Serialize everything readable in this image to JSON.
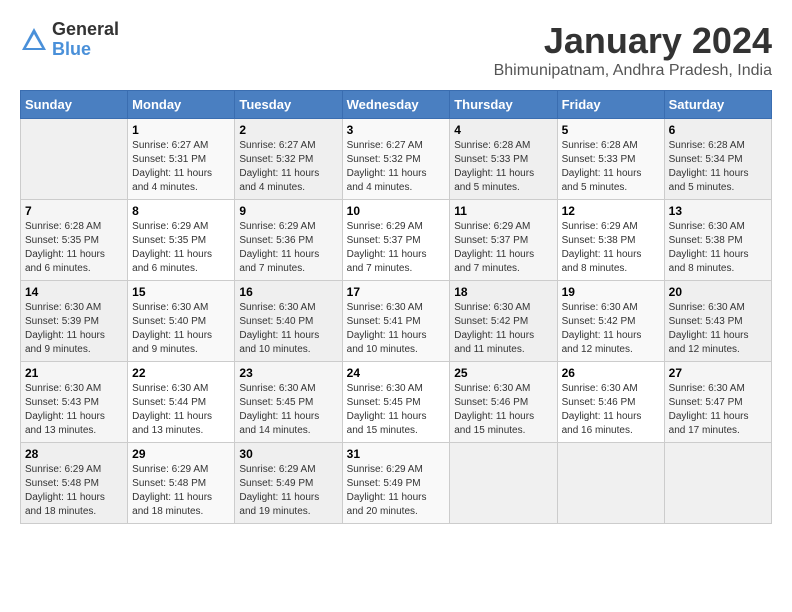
{
  "header": {
    "logo_general": "General",
    "logo_blue": "Blue",
    "main_title": "January 2024",
    "subtitle": "Bhimunipatnam, Andhra Pradesh, India"
  },
  "days_of_week": [
    "Sunday",
    "Monday",
    "Tuesday",
    "Wednesday",
    "Thursday",
    "Friday",
    "Saturday"
  ],
  "weeks": [
    [
      {
        "num": "",
        "info": ""
      },
      {
        "num": "1",
        "info": "Sunrise: 6:27 AM\nSunset: 5:31 PM\nDaylight: 11 hours\nand 4 minutes."
      },
      {
        "num": "2",
        "info": "Sunrise: 6:27 AM\nSunset: 5:32 PM\nDaylight: 11 hours\nand 4 minutes."
      },
      {
        "num": "3",
        "info": "Sunrise: 6:27 AM\nSunset: 5:32 PM\nDaylight: 11 hours\nand 4 minutes."
      },
      {
        "num": "4",
        "info": "Sunrise: 6:28 AM\nSunset: 5:33 PM\nDaylight: 11 hours\nand 5 minutes."
      },
      {
        "num": "5",
        "info": "Sunrise: 6:28 AM\nSunset: 5:33 PM\nDaylight: 11 hours\nand 5 minutes."
      },
      {
        "num": "6",
        "info": "Sunrise: 6:28 AM\nSunset: 5:34 PM\nDaylight: 11 hours\nand 5 minutes."
      }
    ],
    [
      {
        "num": "7",
        "info": "Sunrise: 6:28 AM\nSunset: 5:35 PM\nDaylight: 11 hours\nand 6 minutes."
      },
      {
        "num": "8",
        "info": "Sunrise: 6:29 AM\nSunset: 5:35 PM\nDaylight: 11 hours\nand 6 minutes."
      },
      {
        "num": "9",
        "info": "Sunrise: 6:29 AM\nSunset: 5:36 PM\nDaylight: 11 hours\nand 7 minutes."
      },
      {
        "num": "10",
        "info": "Sunrise: 6:29 AM\nSunset: 5:37 PM\nDaylight: 11 hours\nand 7 minutes."
      },
      {
        "num": "11",
        "info": "Sunrise: 6:29 AM\nSunset: 5:37 PM\nDaylight: 11 hours\nand 7 minutes."
      },
      {
        "num": "12",
        "info": "Sunrise: 6:29 AM\nSunset: 5:38 PM\nDaylight: 11 hours\nand 8 minutes."
      },
      {
        "num": "13",
        "info": "Sunrise: 6:30 AM\nSunset: 5:38 PM\nDaylight: 11 hours\nand 8 minutes."
      }
    ],
    [
      {
        "num": "14",
        "info": "Sunrise: 6:30 AM\nSunset: 5:39 PM\nDaylight: 11 hours\nand 9 minutes."
      },
      {
        "num": "15",
        "info": "Sunrise: 6:30 AM\nSunset: 5:40 PM\nDaylight: 11 hours\nand 9 minutes."
      },
      {
        "num": "16",
        "info": "Sunrise: 6:30 AM\nSunset: 5:40 PM\nDaylight: 11 hours\nand 10 minutes."
      },
      {
        "num": "17",
        "info": "Sunrise: 6:30 AM\nSunset: 5:41 PM\nDaylight: 11 hours\nand 10 minutes."
      },
      {
        "num": "18",
        "info": "Sunrise: 6:30 AM\nSunset: 5:42 PM\nDaylight: 11 hours\nand 11 minutes."
      },
      {
        "num": "19",
        "info": "Sunrise: 6:30 AM\nSunset: 5:42 PM\nDaylight: 11 hours\nand 12 minutes."
      },
      {
        "num": "20",
        "info": "Sunrise: 6:30 AM\nSunset: 5:43 PM\nDaylight: 11 hours\nand 12 minutes."
      }
    ],
    [
      {
        "num": "21",
        "info": "Sunrise: 6:30 AM\nSunset: 5:43 PM\nDaylight: 11 hours\nand 13 minutes."
      },
      {
        "num": "22",
        "info": "Sunrise: 6:30 AM\nSunset: 5:44 PM\nDaylight: 11 hours\nand 13 minutes."
      },
      {
        "num": "23",
        "info": "Sunrise: 6:30 AM\nSunset: 5:45 PM\nDaylight: 11 hours\nand 14 minutes."
      },
      {
        "num": "24",
        "info": "Sunrise: 6:30 AM\nSunset: 5:45 PM\nDaylight: 11 hours\nand 15 minutes."
      },
      {
        "num": "25",
        "info": "Sunrise: 6:30 AM\nSunset: 5:46 PM\nDaylight: 11 hours\nand 15 minutes."
      },
      {
        "num": "26",
        "info": "Sunrise: 6:30 AM\nSunset: 5:46 PM\nDaylight: 11 hours\nand 16 minutes."
      },
      {
        "num": "27",
        "info": "Sunrise: 6:30 AM\nSunset: 5:47 PM\nDaylight: 11 hours\nand 17 minutes."
      }
    ],
    [
      {
        "num": "28",
        "info": "Sunrise: 6:29 AM\nSunset: 5:48 PM\nDaylight: 11 hours\nand 18 minutes."
      },
      {
        "num": "29",
        "info": "Sunrise: 6:29 AM\nSunset: 5:48 PM\nDaylight: 11 hours\nand 18 minutes."
      },
      {
        "num": "30",
        "info": "Sunrise: 6:29 AM\nSunset: 5:49 PM\nDaylight: 11 hours\nand 19 minutes."
      },
      {
        "num": "31",
        "info": "Sunrise: 6:29 AM\nSunset: 5:49 PM\nDaylight: 11 hours\nand 20 minutes."
      },
      {
        "num": "",
        "info": ""
      },
      {
        "num": "",
        "info": ""
      },
      {
        "num": "",
        "info": ""
      }
    ]
  ]
}
